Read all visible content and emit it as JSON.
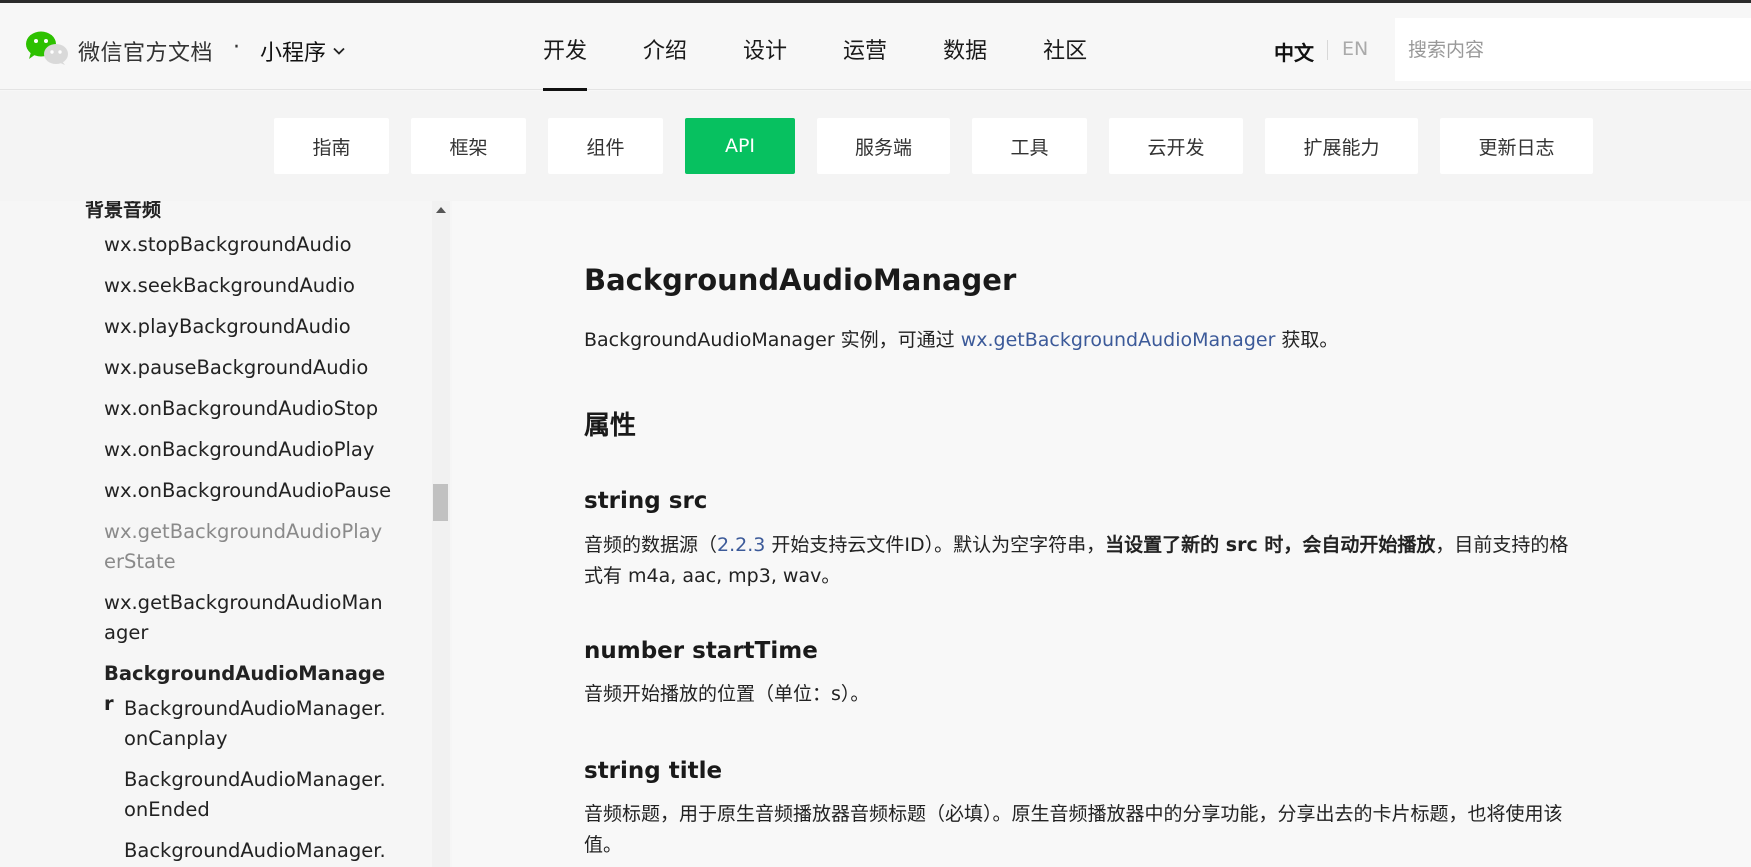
{
  "header": {
    "brand": "微信官方文档",
    "separator": "·",
    "product": "小程序",
    "nav": [
      {
        "label": "开发",
        "active": true
      },
      {
        "label": "介绍"
      },
      {
        "label": "设计"
      },
      {
        "label": "运营"
      },
      {
        "label": "数据"
      },
      {
        "label": "社区"
      }
    ],
    "lang_zh": "中文",
    "lang_en": "EN",
    "search_placeholder": "搜索内容"
  },
  "subnav": [
    {
      "label": "指南"
    },
    {
      "label": "框架"
    },
    {
      "label": "组件"
    },
    {
      "label": "API",
      "active": true
    },
    {
      "label": "服务端"
    },
    {
      "label": "工具"
    },
    {
      "label": "云开发"
    },
    {
      "label": "扩展能力"
    },
    {
      "label": "更新日志"
    }
  ],
  "sidebar": {
    "group_title": "背景音频",
    "items": [
      {
        "label": "wx.stopBackgroundAudio"
      },
      {
        "label": "wx.seekBackgroundAudio"
      },
      {
        "label": "wx.playBackgroundAudio"
      },
      {
        "label": "wx.pauseBackgroundAudio"
      },
      {
        "label": "wx.onBackgroundAudioStop"
      },
      {
        "label": "wx.onBackgroundAudioPlay"
      },
      {
        "label": "wx.onBackgroundAudioPause"
      },
      {
        "label": "wx.getBackgroundAudioPlayerState"
      },
      {
        "label": "wx.getBackgroundAudioManager"
      },
      {
        "label": "BackgroundAudioManager"
      },
      {
        "label": "BackgroundAudioManager.onCanplay"
      },
      {
        "label": "BackgroundAudioManager.onEnded"
      },
      {
        "label": "BackgroundAudioManager.o"
      }
    ]
  },
  "content": {
    "title": "BackgroundAudioManager",
    "intro_prefix": "BackgroundAudioManager 实例，可通过 ",
    "intro_link": "wx.getBackgroundAudioManager",
    "intro_suffix": " 获取。",
    "section_title": "属性",
    "props": [
      {
        "heading": "string src",
        "desc_1": "音频的数据源（",
        "desc_link": "2.2.3",
        "desc_2": " 开始支持云文件ID）。默认为空字符串，",
        "desc_bold": "当设置了新的 src 时，会自动开始播放",
        "desc_3": "，目前支持的格式有 m4a, aac, mp3, wav。"
      },
      {
        "heading": "number startTime",
        "desc": "音频开始播放的位置（单位：s）。"
      },
      {
        "heading": "string title",
        "desc": "音频标题，用于原生音频播放器音频标题（必填）。原生音频播放器中的分享功能，分享出去的卡片标题，也将使用该值。"
      }
    ]
  },
  "icons": {
    "logo": "wechat-logo-icon",
    "dropdown": "chevron-down-icon",
    "scroll_up": "scroll-up-arrow-icon"
  },
  "colors": {
    "accent": "#07c160",
    "link": "#3c5a99"
  }
}
